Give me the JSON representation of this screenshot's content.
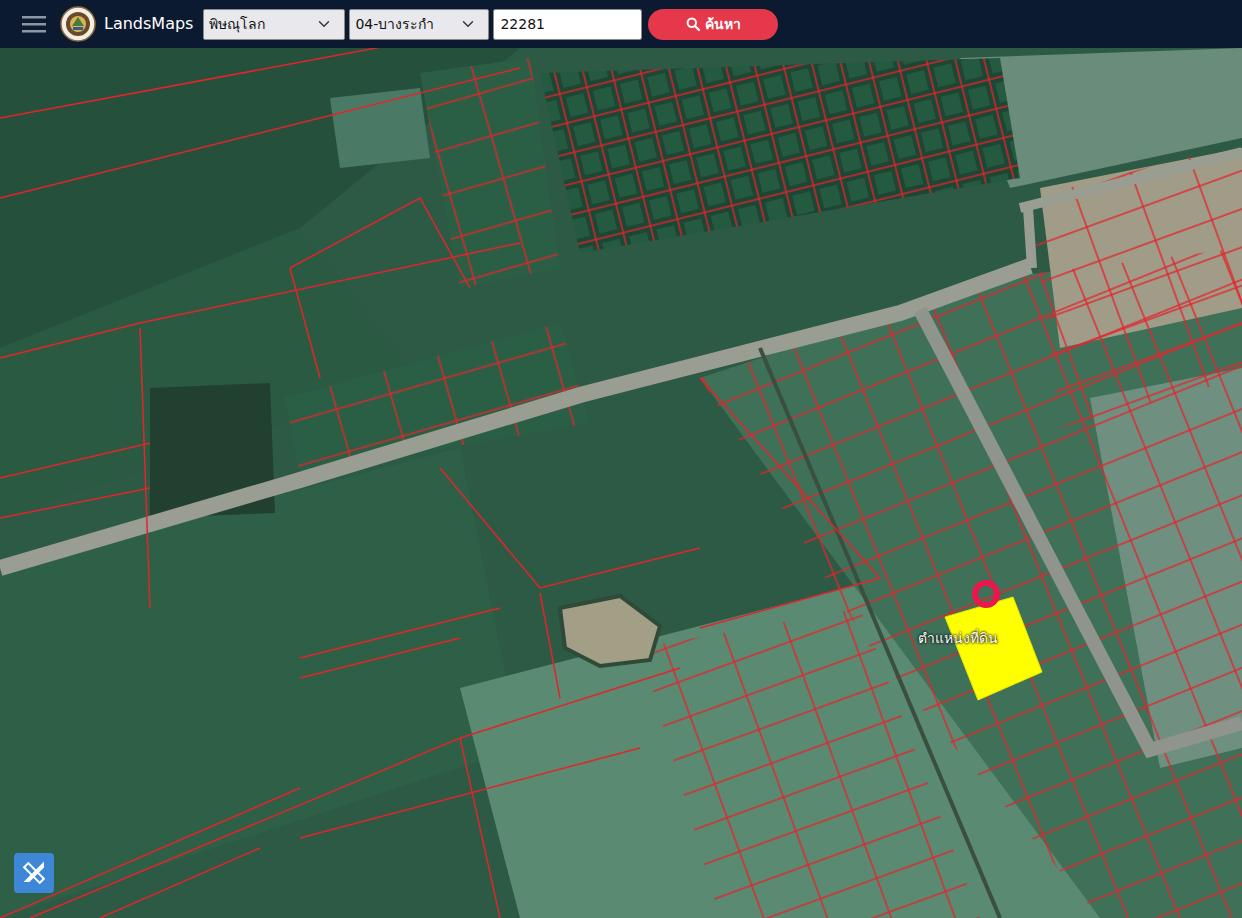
{
  "header": {
    "brand": "LandsMaps",
    "province": {
      "value": "พิษณุโลก"
    },
    "district": {
      "value": "04-บางระกำ"
    },
    "parcel_number": {
      "value": "22281"
    },
    "search_button": {
      "label": "ค้นหา"
    }
  },
  "map": {
    "parcel": {
      "label": "ตำแหน่งที่ดิน",
      "highlighted": true
    }
  }
}
